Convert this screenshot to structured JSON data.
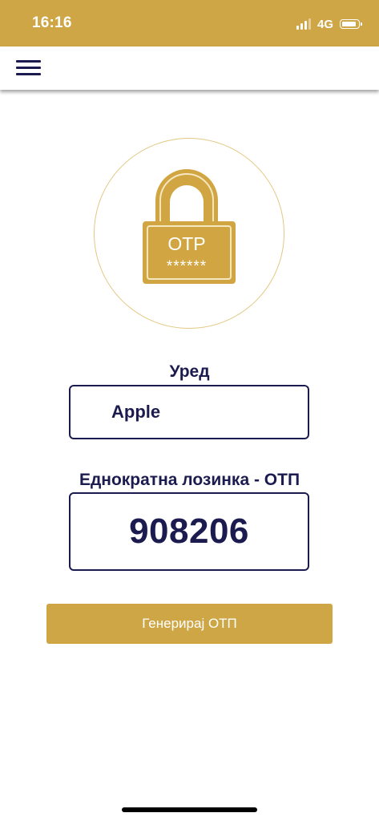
{
  "status_bar": {
    "time": "16:16",
    "network": "4G",
    "signal_icon": "cellular-signal-icon",
    "battery_icon": "battery-icon",
    "background_color": "#cfa646"
  },
  "app_bar": {
    "menu_icon": "hamburger-menu-icon"
  },
  "lock_icon": {
    "name": "otp-padlock-icon",
    "text": "OTP",
    "mask": "******",
    "color": "#d1a642"
  },
  "device": {
    "label": "Уред",
    "value": "Apple"
  },
  "otp": {
    "label": "Еднократна лозинка - ОТП",
    "value": "908206"
  },
  "generate_button": {
    "label": "Генерирај ОТП"
  },
  "colors": {
    "accent": "#cfa646",
    "text_dark": "#1b1b4f"
  }
}
